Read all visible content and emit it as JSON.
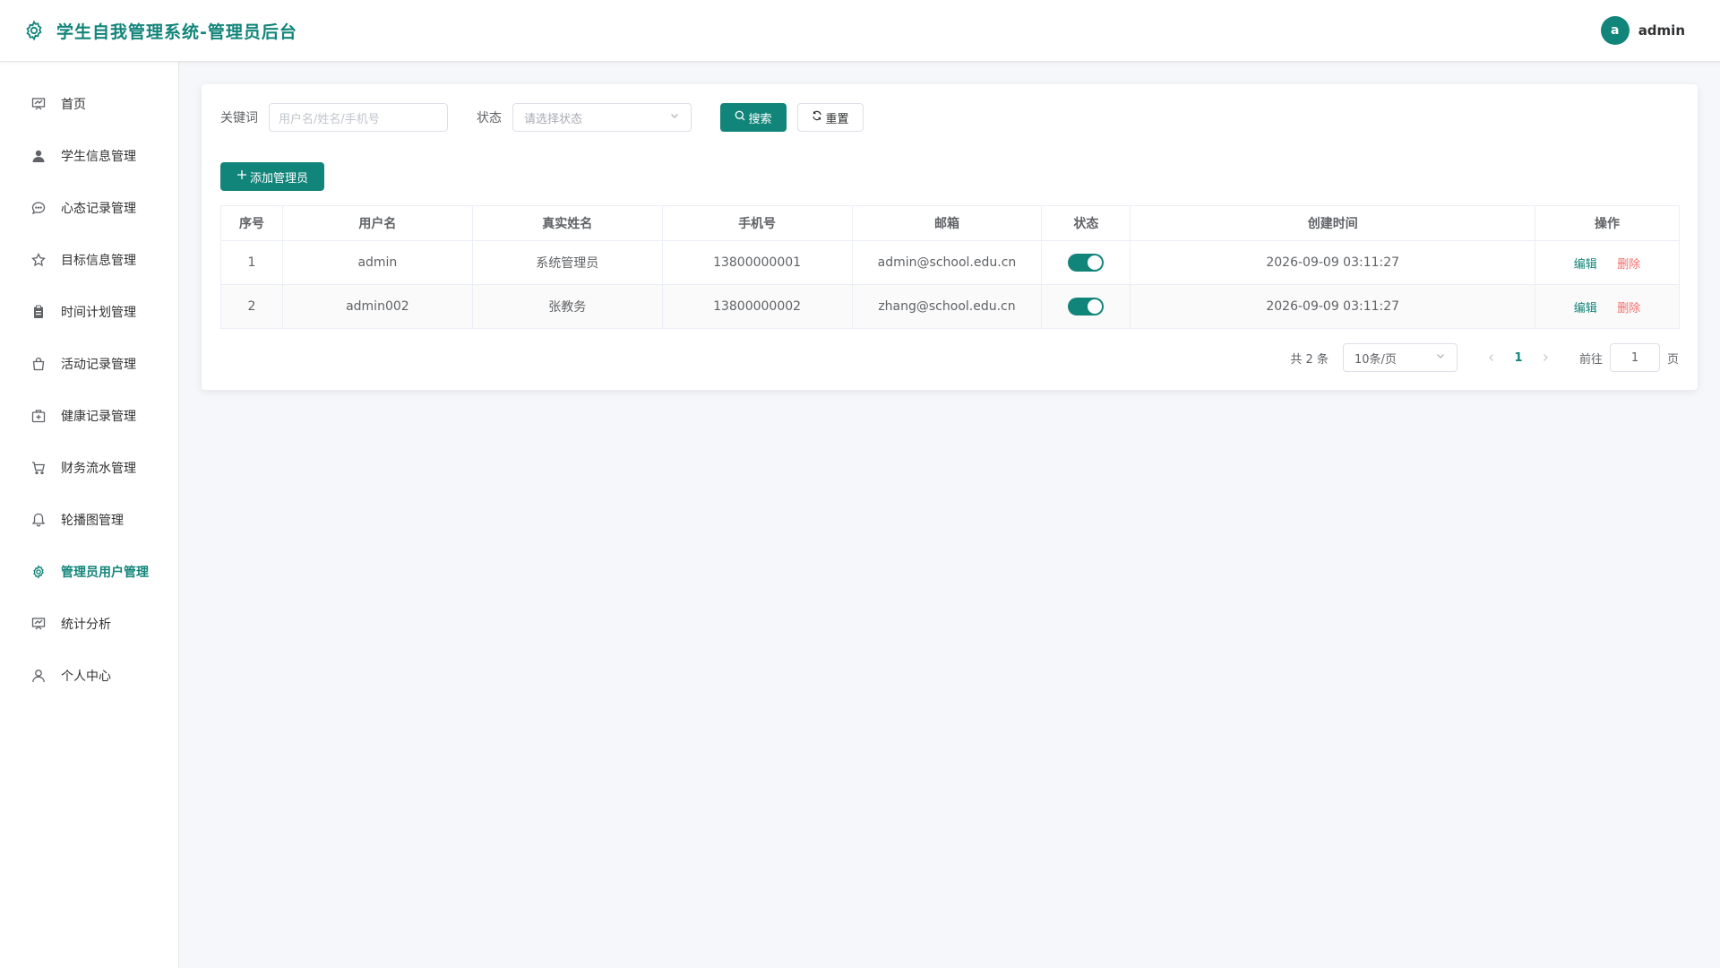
{
  "header": {
    "title": "学生自我管理系统-管理员后台",
    "user": {
      "avatar_letter": "a",
      "name": "admin"
    }
  },
  "sidebar": {
    "items": [
      {
        "label": "首页",
        "icon": "dashboard-icon",
        "active": false
      },
      {
        "label": "学生信息管理",
        "icon": "user-filled-icon",
        "active": false
      },
      {
        "label": "心态记录管理",
        "icon": "chat-icon",
        "active": false
      },
      {
        "label": "目标信息管理",
        "icon": "star-icon",
        "active": false
      },
      {
        "label": "时间计划管理",
        "icon": "clipboard-icon",
        "active": false
      },
      {
        "label": "活动记录管理",
        "icon": "shopping-bag-icon",
        "active": false
      },
      {
        "label": "健康记录管理",
        "icon": "first-aid-kit-icon",
        "active": false
      },
      {
        "label": "财务流水管理",
        "icon": "shopping-cart-icon",
        "active": false
      },
      {
        "label": "轮播图管理",
        "icon": "bell-icon",
        "active": false
      },
      {
        "label": "管理员用户管理",
        "icon": "gear-icon",
        "active": true
      },
      {
        "label": "统计分析",
        "icon": "presentation-icon",
        "active": false
      },
      {
        "label": "个人中心",
        "icon": "user-icon",
        "active": false
      }
    ]
  },
  "filters": {
    "keyword_label": "关键词",
    "keyword_placeholder": "用户名/姓名/手机号",
    "status_label": "状态",
    "status_placeholder": "请选择状态",
    "search_label": "搜索",
    "reset_label": "重置"
  },
  "add_button": "添加管理员",
  "table": {
    "columns": [
      "序号",
      "用户名",
      "真实姓名",
      "手机号",
      "邮箱",
      "状态",
      "创建时间",
      "操作"
    ],
    "rows": [
      {
        "index": "1",
        "username": "admin",
        "realname": "系统管理员",
        "phone": "13800000001",
        "email": "admin@school.edu.cn",
        "enabled": true,
        "created": "2026-09-09 03:11:27"
      },
      {
        "index": "2",
        "username": "admin002",
        "realname": "张教务",
        "phone": "13800000002",
        "email": "zhang@school.edu.cn",
        "enabled": true,
        "created": "2026-09-09 03:11:27"
      }
    ],
    "edit_label": "编辑",
    "delete_label": "删除"
  },
  "pagination": {
    "total_text": "共 2 条",
    "page_size": "10条/页",
    "current_page": "1",
    "jump_label": "前往",
    "jump_value": "1",
    "jump_unit": "页"
  },
  "colors": {
    "primary": "#12857a",
    "danger": "#f56c6c"
  }
}
